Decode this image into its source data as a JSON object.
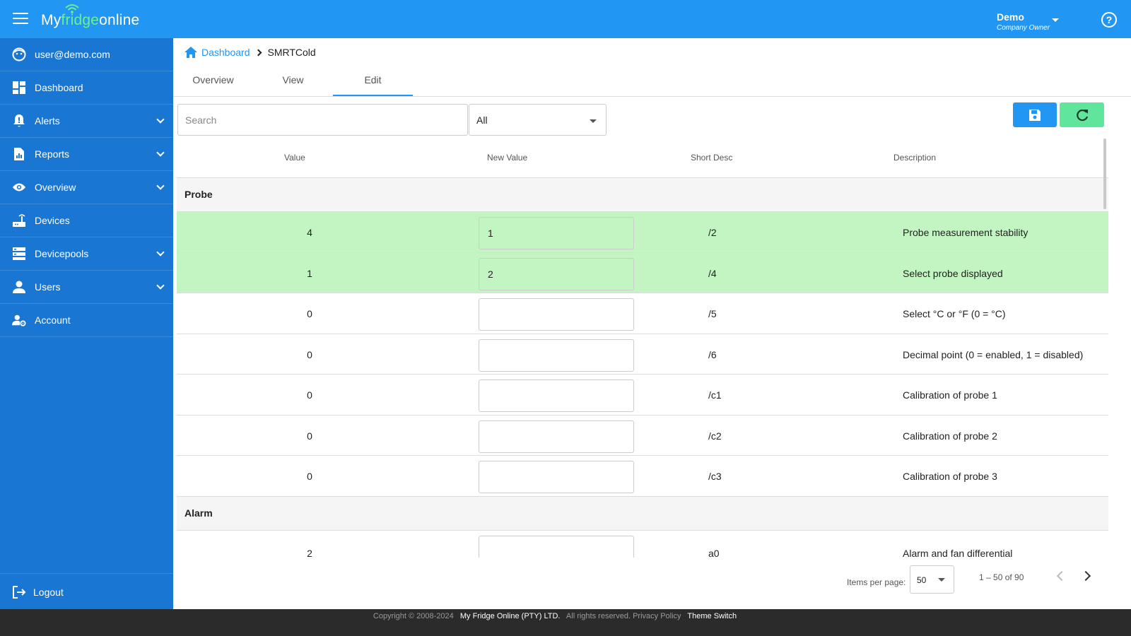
{
  "header": {
    "logo": {
      "part1": "My",
      "part2": "fridge",
      "part3": "online"
    },
    "user_name": "Demo",
    "user_role": "Company Owner"
  },
  "sidebar": {
    "items": [
      {
        "label": "user@demo.com",
        "icon": "account-face-icon"
      },
      {
        "label": "Dashboard",
        "icon": "dashboard-icon"
      },
      {
        "label": "Alerts",
        "icon": "bell-alert-icon"
      },
      {
        "label": "Reports",
        "icon": "report-icon"
      },
      {
        "label": "Overview",
        "icon": "eye-icon"
      },
      {
        "label": "Devices",
        "icon": "router-icon"
      },
      {
        "label": "Devicepools",
        "icon": "storage-icon"
      },
      {
        "label": "Users",
        "icon": "person-icon"
      },
      {
        "label": "Account",
        "icon": "account-settings-icon"
      }
    ],
    "logout": "Logout"
  },
  "breadcrumb": {
    "home": "Dashboard",
    "current": "SMRTCold"
  },
  "tabs": [
    "Overview",
    "View",
    "Edit"
  ],
  "active_tab": "Edit",
  "search": {
    "placeholder": "Search",
    "value": ""
  },
  "filter": {
    "selected": "All"
  },
  "table": {
    "headers": {
      "value": "Value",
      "new_value": "New Value",
      "short_desc": "Short Desc",
      "description": "Description"
    },
    "groups": [
      {
        "name": "Probe",
        "rows": [
          {
            "value": "4",
            "new_value": "1",
            "short": "/2",
            "desc": "Probe measurement stability",
            "changed": true
          },
          {
            "value": "1",
            "new_value": "2",
            "short": "/4",
            "desc": "Select probe displayed",
            "changed": true
          },
          {
            "value": "0",
            "new_value": "",
            "short": "/5",
            "desc": "Select °C or °F (0 = °C)",
            "changed": false
          },
          {
            "value": "0",
            "new_value": "",
            "short": "/6",
            "desc": "Decimal point (0 = enabled, 1 = disabled)",
            "changed": false
          },
          {
            "value": "0",
            "new_value": "",
            "short": "/c1",
            "desc": "Calibration of probe 1",
            "changed": false
          },
          {
            "value": "0",
            "new_value": "",
            "short": "/c2",
            "desc": "Calibration of probe 2",
            "changed": false
          },
          {
            "value": "0",
            "new_value": "",
            "short": "/c3",
            "desc": "Calibration of probe 3",
            "changed": false
          }
        ]
      },
      {
        "name": "Alarm",
        "rows": [
          {
            "value": "2",
            "new_value": "",
            "short": "a0",
            "desc": "Alarm and fan differential",
            "changed": false
          }
        ]
      }
    ]
  },
  "paginator": {
    "items_per_page_label": "Items per page:",
    "items_per_page": "50",
    "range": "1 – 50 of 90"
  },
  "footer": {
    "copyright": "Copyright © 2008-2024",
    "company": "My Fridge Online (PTY) LTD.",
    "rights": "All rights reserved.",
    "privacy": "Privacy Policy",
    "theme": "Theme Switch"
  },
  "colors": {
    "primary": "#2196f3",
    "sidebar": "#1976d2",
    "accent_green": "#5fe59c",
    "changed_row": "#c3f5c3"
  }
}
